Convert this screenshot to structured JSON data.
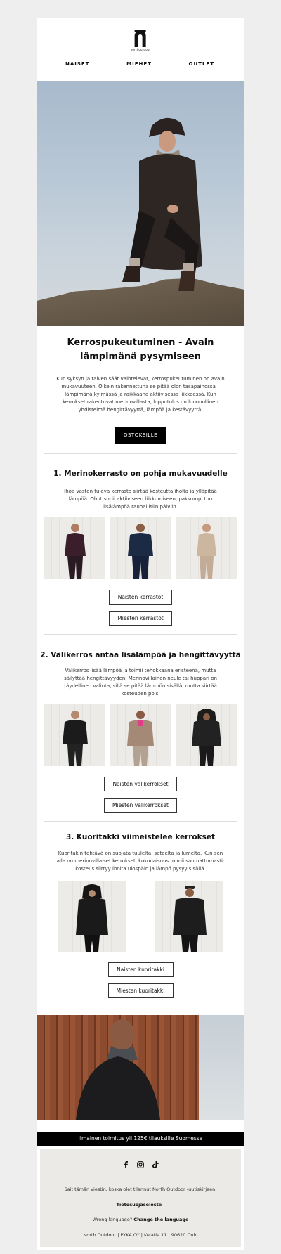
{
  "header": {
    "logo_text": "northoutdoor",
    "nav": [
      "NAISET",
      "MIEHET",
      "OUTLET"
    ]
  },
  "intro": {
    "title": "Kerrospukeutuminen - Avain lämpimänä pysymiseen",
    "body": "Kun syksyn ja talven säät vaihtelevat, kerrospukeutuminen on avain mukavuuteen. Oikein rakennettuna se pitää olon tasapainossa – lämpimänä kylmässä ja raikkaana aktiivisessa liikkeessä. Kun kerrokset rakentuvat merinovillasta, lopputulos on luonnollinen yhdistelmä hengittävyyttä, lämpöä ja kestävyyttä.",
    "button": "OSTOKSILLE"
  },
  "section1": {
    "title": "1. Merinokerrasto on pohja mukavuudelle",
    "body": "Ihoa vasten tuleva kerrasto siirtää kosteutta iholta ja ylläpitää lämpöä. Ohut sopii aktiiviseen liikkumiseen, paksumpi tuo lisälämpöä rauhallisiin päiviin.",
    "buttons": [
      "Naisten kerrastot",
      "Miesten kerrastot"
    ]
  },
  "section2": {
    "title": "2. Välikerros antaa lisälämpöä ja hengittävyyttä",
    "body": "Välikerros lisää lämpöä ja toimii tehokkaana eristeenä, mutta säilyttää hengittävyyden. Merinovillainen neule tai huppari on täydellinen valinta, sillä se pitää lämmön sisällä, mutta siirtää kosteuden pois.",
    "buttons": [
      "Naisten välikerrokset",
      "Miesten välikerrokset"
    ]
  },
  "section3": {
    "title": "3. Kuoritakki viimeistelee kerrokset",
    "body": "Kuoritakin tehtävä on suojata tuulelta, sateelta ja lumelta. Kun sen alla on merinovillaiset kerrokset, kokonaisuus toimii saumattomasti: kosteus siirtyy iholta ulospäin ja lämpö pysyy sisällä.",
    "buttons": [
      "Naisten kuoritakki",
      "Miesten kuoritakki"
    ]
  },
  "shipping_bar": "Ilmainen toimitus yli 125€ tilauksille Suomessa",
  "footer": {
    "social_icons": [
      "facebook-icon",
      "instagram-icon",
      "tiktok-icon"
    ],
    "reason": "Sait tämän viestin, koska olet tilannut North Outdoor -uutiskirjeen.",
    "privacy": "Tietosuojaseloste",
    "privacy_sep": " |",
    "wrong_lang": "Wrong language?",
    "change_lang": "Change the language",
    "address": "North Outdoor | PYKA OY | Kelatie 11 | 90620 Oulu"
  }
}
